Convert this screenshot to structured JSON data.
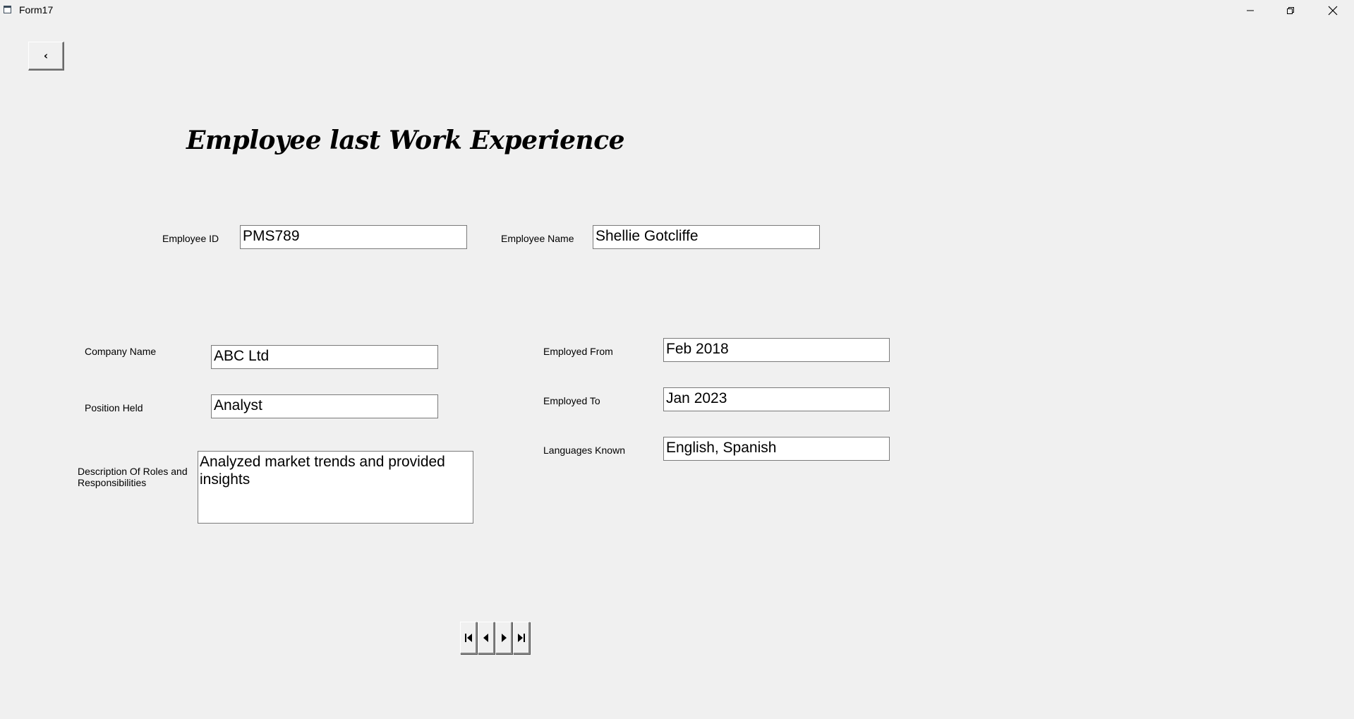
{
  "window": {
    "title": "Form17",
    "minimize_icon": "minimize-icon",
    "restore_icon": "restore-icon",
    "close_icon": "close-icon"
  },
  "toolbar": {
    "back_label": "‹"
  },
  "heading": "Employee last Work Experience",
  "form": {
    "employee_id_label": "Employee ID",
    "employee_id_value": "PMS789",
    "employee_name_label": "Employee Name",
    "employee_name_value": "Shellie Gotcliffe",
    "company_name_label": "Company Name",
    "company_name_value": "ABC Ltd",
    "position_held_label": "Position Held",
    "position_held_value": "Analyst",
    "description_label": "Description Of Roles and Responsibilities",
    "description_value": "Analyzed market trends and provided insights",
    "employed_from_label": "Employed From",
    "employed_from_value": "Feb 2018",
    "employed_to_label": "Employed To",
    "employed_to_value": "Jan 2023",
    "languages_label": "Languages Known",
    "languages_value": "English, Spanish"
  },
  "navigator": {
    "first_icon": "first-record-icon",
    "prev_icon": "previous-record-icon",
    "next_icon": "next-record-icon",
    "last_icon": "last-record-icon"
  }
}
